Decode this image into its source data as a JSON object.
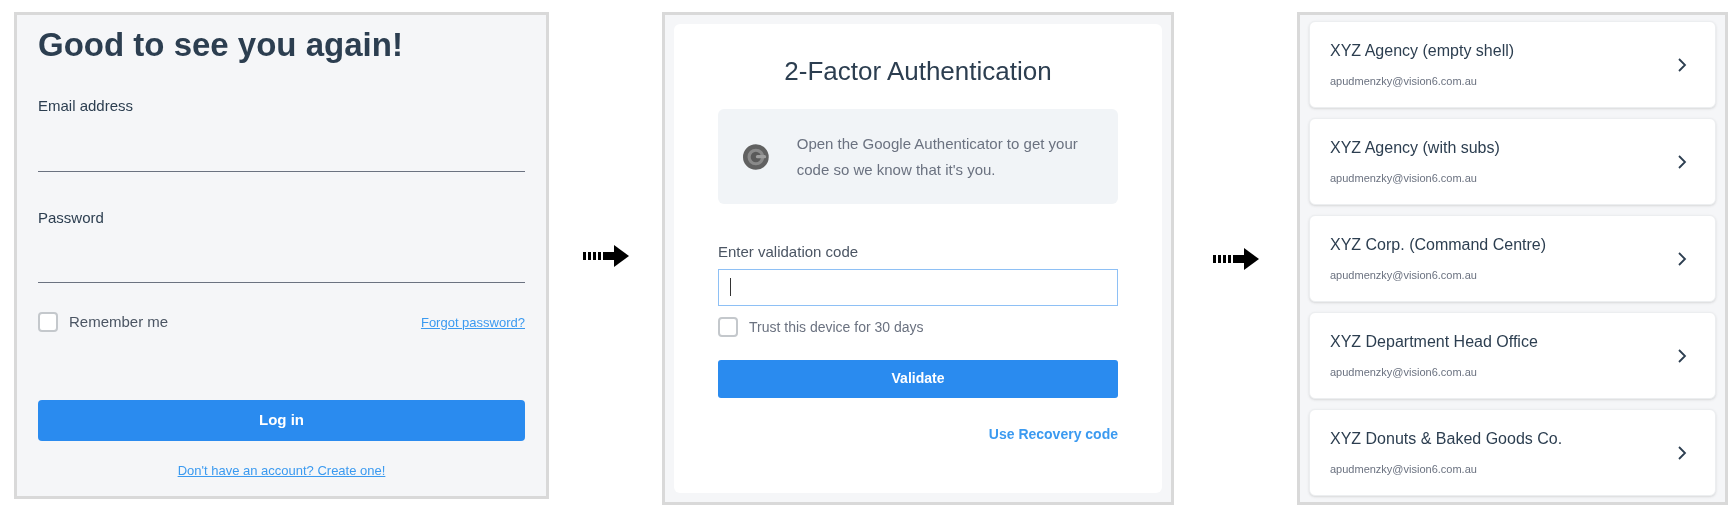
{
  "login": {
    "title": "Good to see you again!",
    "fields": [
      {
        "label": "Email address"
      },
      {
        "label": "Password"
      }
    ],
    "remember": {
      "label": "Remember me",
      "checked": false
    },
    "forgot_link": "Forgot password?",
    "login_button": "Log in",
    "signup_link": "Don't have an account? Create one!"
  },
  "two_factor": {
    "title": "2-Factor Authentication",
    "info": "Open the Google Authenticator to get your code so we know that it's you.",
    "field_label": "Enter validation code",
    "field": {
      "focused": true
    },
    "trust": {
      "label": "Trust this device for 30 days",
      "checked": false
    },
    "validate_button": "Validate",
    "recovery_link": "Use Recovery code"
  },
  "accounts": [
    {
      "name": "XYZ Agency (empty shell)",
      "email": "apudmenzky@vision6.com.au"
    },
    {
      "name": "XYZ Agency (with subs)",
      "email": "apudmenzky@vision6.com.au"
    },
    {
      "name": "XYZ Corp. (Command Centre)",
      "email": "apudmenzky@vision6.com.au"
    },
    {
      "name": "XYZ Department Head Office",
      "email": "apudmenzky@vision6.com.au"
    },
    {
      "name": "XYZ Donuts & Baked Goods Co.",
      "email": "apudmenzky@vision6.com.au"
    }
  ]
}
